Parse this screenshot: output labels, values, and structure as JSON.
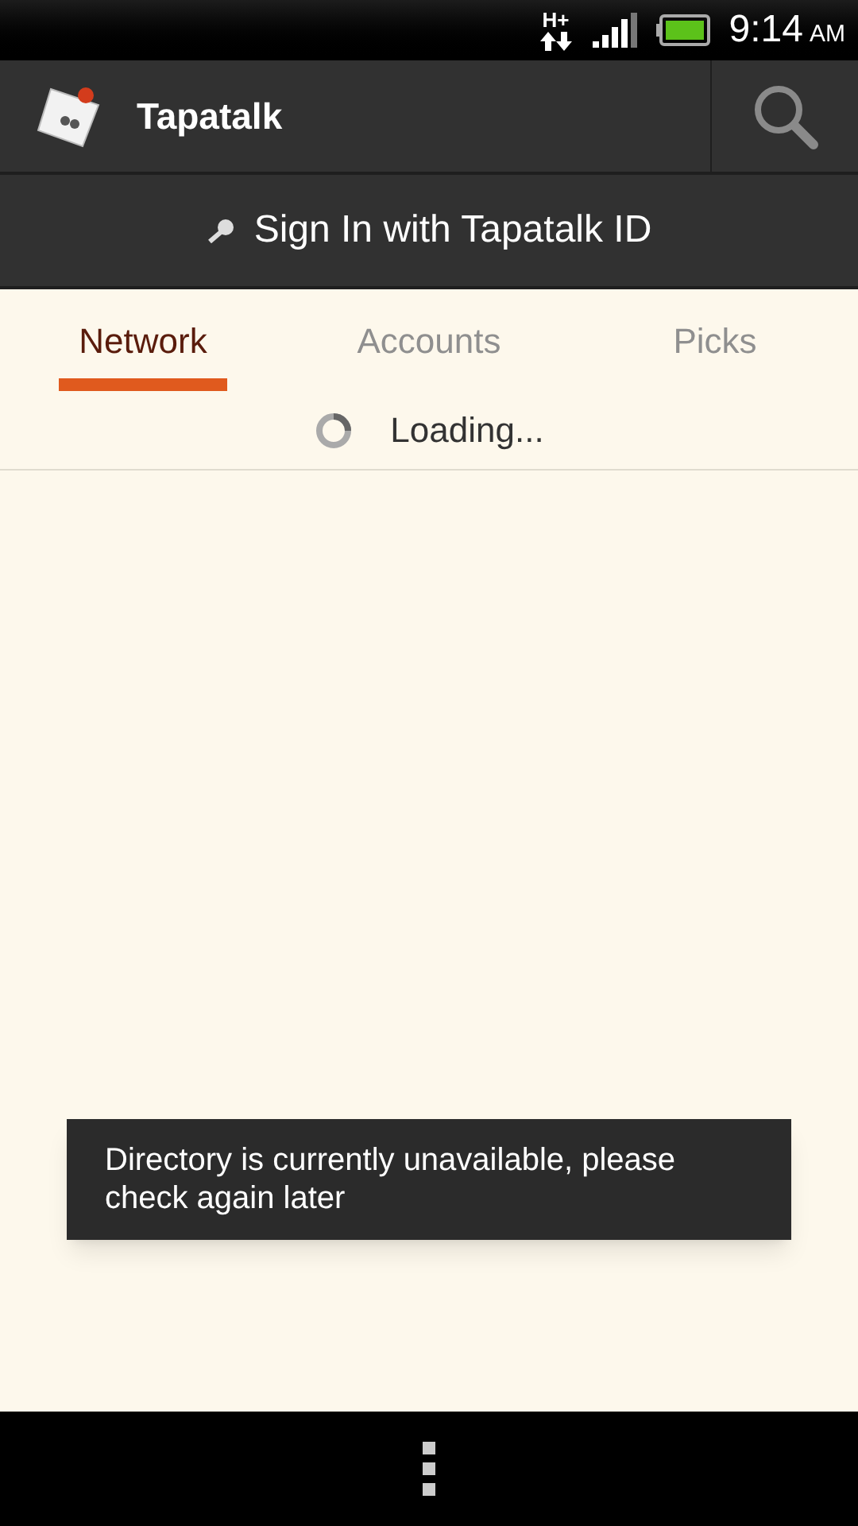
{
  "status_bar": {
    "network": "H+",
    "time": "9:14",
    "meridiem": "AM"
  },
  "app_bar": {
    "title": "Tapatalk"
  },
  "sign_in": {
    "label": "Sign In with Tapatalk ID"
  },
  "tabs": [
    {
      "label": "Network",
      "selected": true
    },
    {
      "label": "Accounts",
      "selected": false
    },
    {
      "label": "Picks",
      "selected": false
    }
  ],
  "loading": {
    "label": "Loading..."
  },
  "toast": {
    "message": "Directory is currently unavailable, please check again later"
  }
}
